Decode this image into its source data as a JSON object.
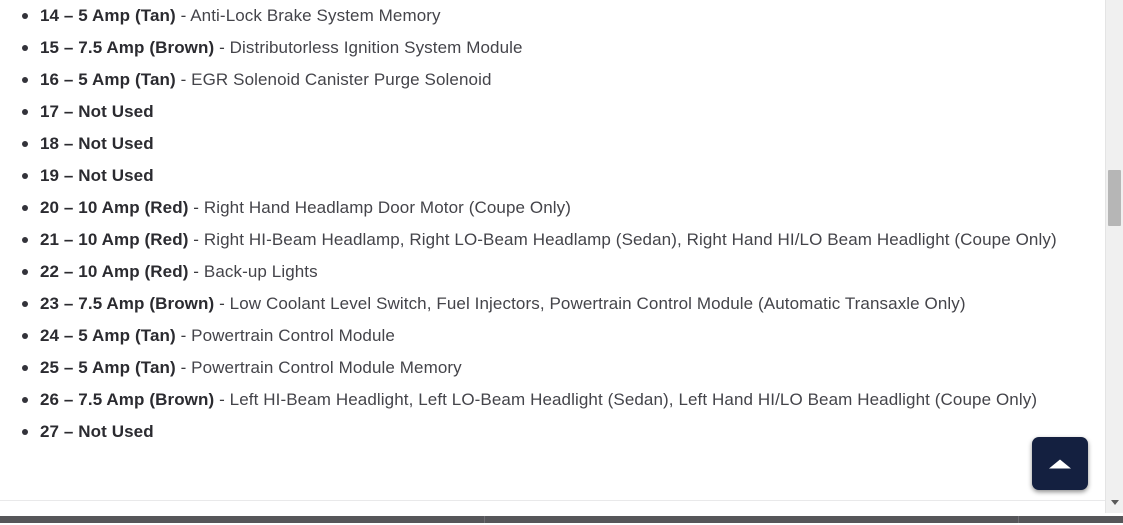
{
  "page": {
    "list_type": "fuse-box-legend",
    "items": [
      {
        "lead": "14 – 5 Amp (Tan)",
        "separator": " - ",
        "desc": "Anti-Lock Brake System Memory"
      },
      {
        "lead": "15 – 7.5 Amp (Brown)",
        "separator": " - ",
        "desc": "Distributorless Ignition System Module"
      },
      {
        "lead": "16 – 5 Amp (Tan)",
        "separator": " - ",
        "desc": "EGR Solenoid Canister Purge Solenoid"
      },
      {
        "lead": "17 – Not Used",
        "separator": "",
        "desc": ""
      },
      {
        "lead": "18 – Not Used",
        "separator": "",
        "desc": ""
      },
      {
        "lead": "19 – Not Used",
        "separator": "",
        "desc": ""
      },
      {
        "lead": "20 – 10 Amp (Red)",
        "separator": " - ",
        "desc": "Right Hand Headlamp Door Motor (Coupe Only)"
      },
      {
        "lead": "21 – 10 Amp (Red)",
        "separator": " - ",
        "desc": "Right HI-Beam Headlamp, Right LO-Beam Headlamp (Sedan), Right Hand HI/LO Beam Headlight (Coupe Only)"
      },
      {
        "lead": "22 – 10 Amp (Red)",
        "separator": " - ",
        "desc": "Back-up Lights"
      },
      {
        "lead": "23 – 7.5 Amp (Brown)",
        "separator": " - ",
        "desc": "Low Coolant Level Switch, Fuel Injectors, Powertrain Control Module (Automatic Transaxle Only)"
      },
      {
        "lead": "24 – 5 Amp (Tan)",
        "separator": " - ",
        "desc": "Powertrain Control Module"
      },
      {
        "lead": "25 – 5 Amp (Tan)",
        "separator": " - ",
        "desc": "Powertrain Control Module Memory"
      },
      {
        "lead": "26 – 7.5 Amp (Brown)",
        "separator": " - ",
        "desc": "Left HI-Beam Headlight, Left LO-Beam Headlight (Sedan), Left Hand HI/LO Beam Headlight (Coupe Only)"
      },
      {
        "lead": "27 – Not Used",
        "separator": "",
        "desc": ""
      }
    ]
  },
  "controls": {
    "scroll_top": {
      "icon": "triangle-up-icon",
      "label": "",
      "color": "#142040"
    },
    "vertical_scrollbar": {
      "thumb_color": "#b6b6b6",
      "track_color": "#f0f0f0",
      "down_arrow_icon": "chevron-down-icon"
    },
    "horizontal_scrollbar": {
      "track_color": "#565659"
    }
  }
}
